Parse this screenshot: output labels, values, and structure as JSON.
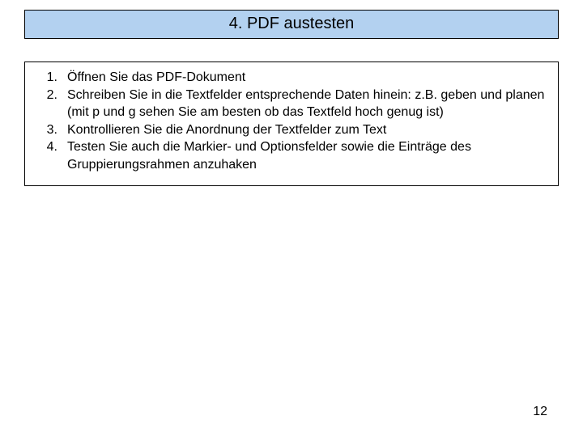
{
  "title": "4. PDF austesten",
  "items": [
    {
      "num": "1.",
      "text": "Öffnen Sie das PDF-Dokument"
    },
    {
      "num": "2.",
      "text": "Schreiben Sie in die Textfelder entsprechende Daten hinein: z.B. geben und planen (mit p und g sehen Sie am besten ob das Textfeld hoch genug ist)"
    },
    {
      "num": "3.",
      "text": "Kontrollieren Sie die Anordnung der Textfelder zum Text"
    },
    {
      "num": "4.",
      "text": "Testen Sie auch die Markier- und Optionsfelder sowie die Einträge des Gruppierungsrahmen anzuhaken"
    }
  ],
  "page_number": "12"
}
